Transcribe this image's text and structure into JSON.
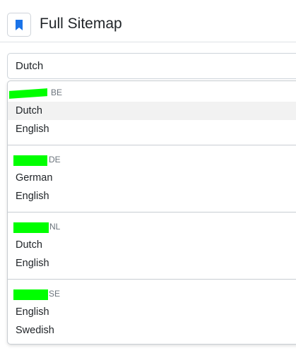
{
  "header": {
    "title": "Full Sitemap",
    "icon": "bookmark-icon",
    "accent_color": "#1a73e8"
  },
  "select": {
    "value": "Dutch"
  },
  "dropdown": {
    "redaction_color": "#00ff00",
    "groups": [
      {
        "code": "BE",
        "options": [
          "Dutch",
          "English"
        ],
        "highlighted": "Dutch"
      },
      {
        "code": "DE",
        "options": [
          "German",
          "English"
        ]
      },
      {
        "code": "NL",
        "options": [
          "Dutch",
          "English"
        ]
      },
      {
        "code": "SE",
        "options": [
          "English",
          "Swedish"
        ]
      }
    ]
  }
}
